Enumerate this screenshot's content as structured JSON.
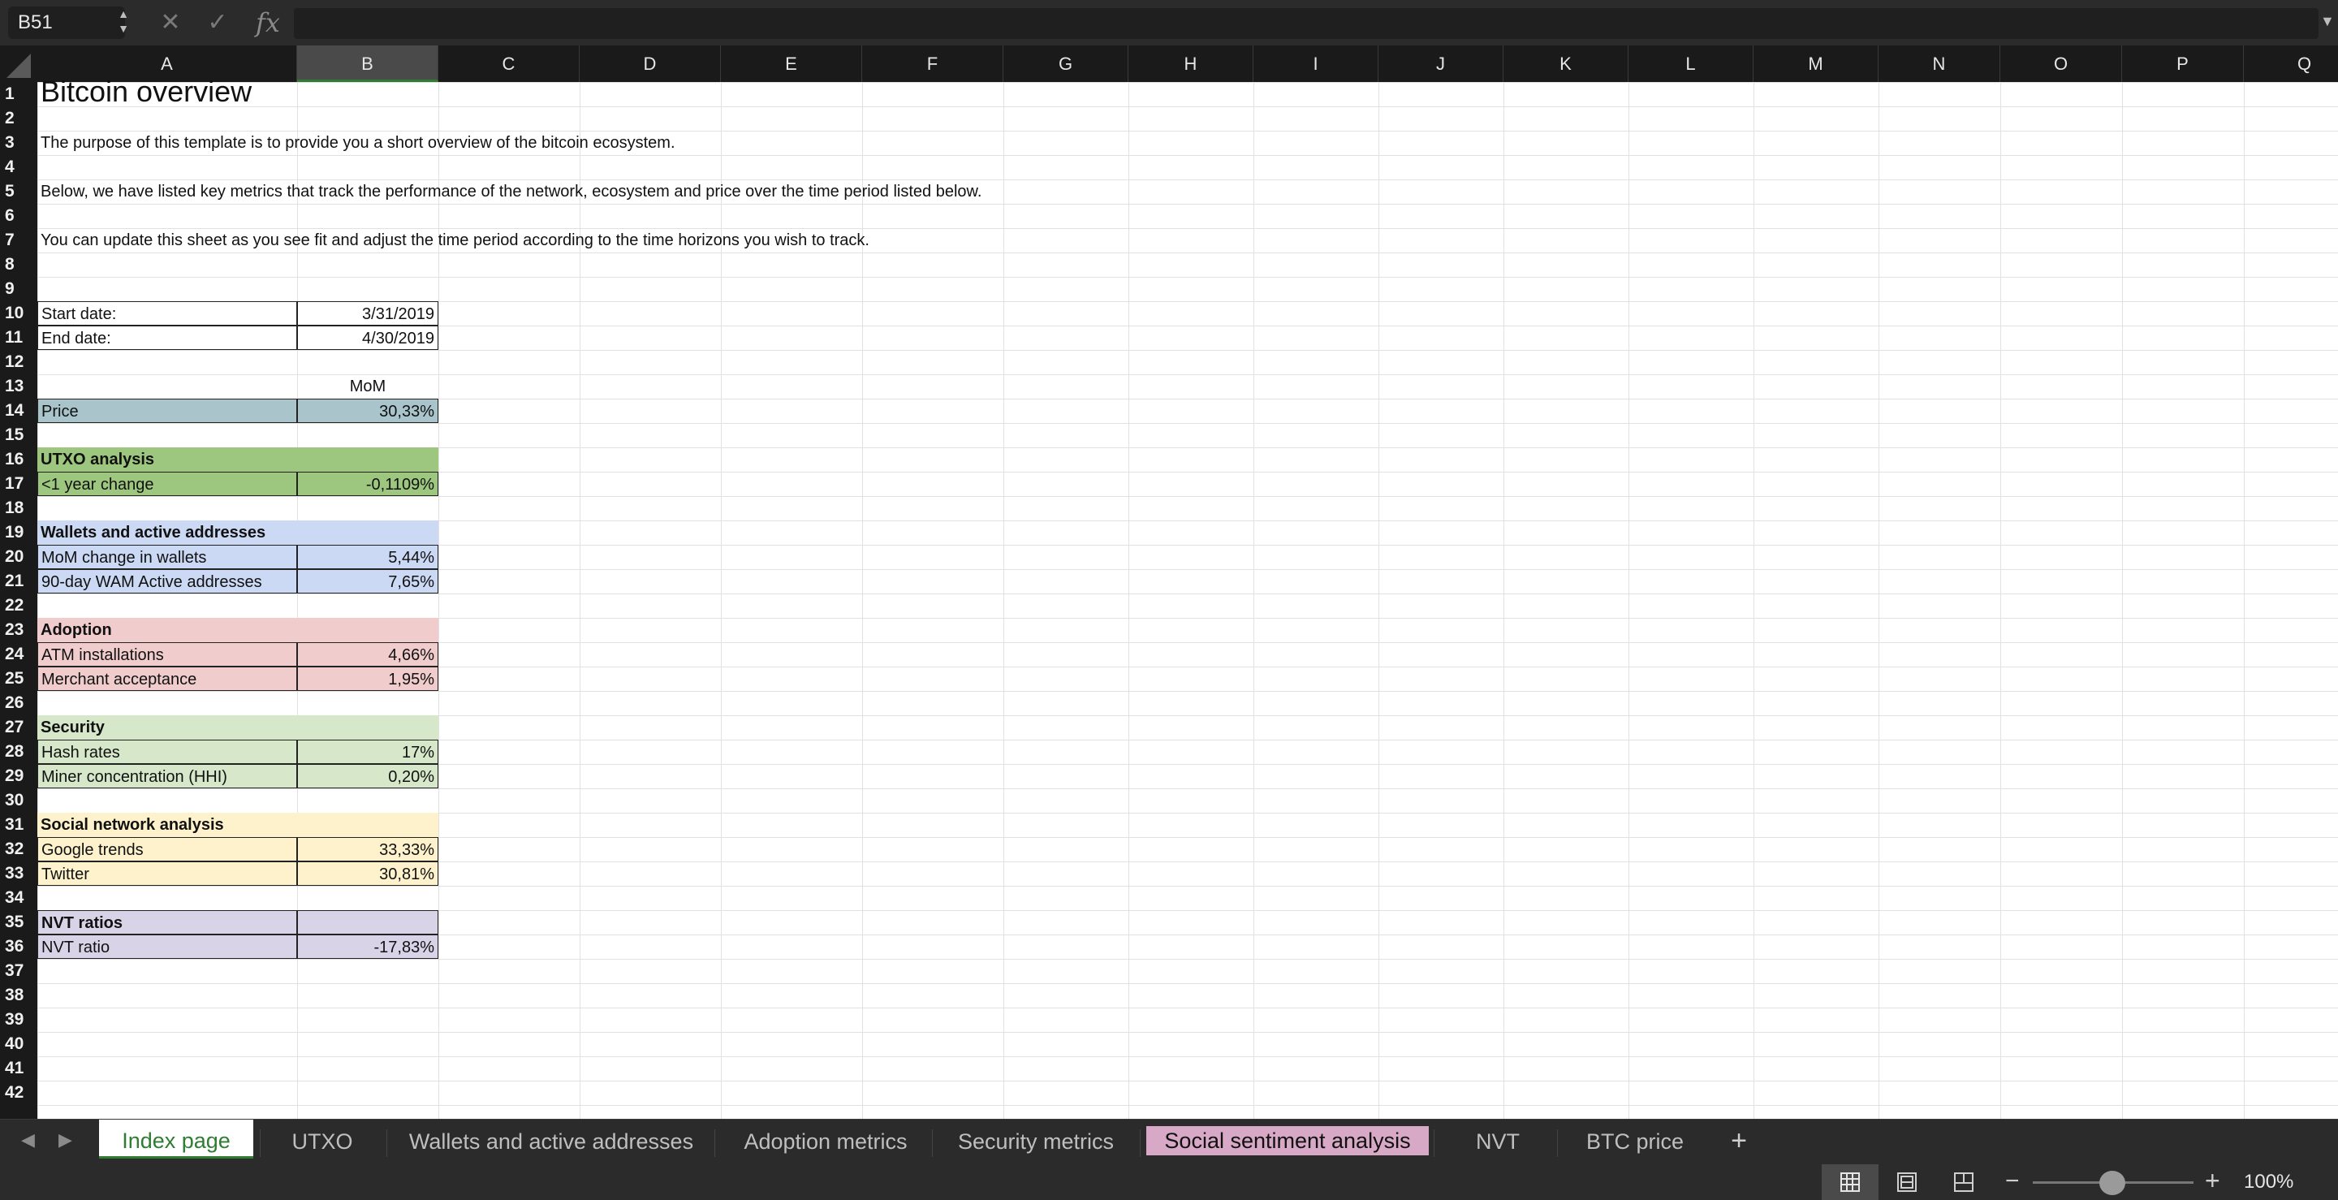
{
  "formula_bar": {
    "name_box": "B51",
    "formula": ""
  },
  "columns": [
    "A",
    "B",
    "C",
    "D",
    "E",
    "F",
    "G",
    "H",
    "I",
    "J",
    "K",
    "L",
    "M",
    "N",
    "O",
    "P",
    "Q"
  ],
  "selected_column": "B",
  "rows": [
    "1",
    "2",
    "3",
    "4",
    "5",
    "6",
    "7",
    "8",
    "9",
    "10",
    "11",
    "12",
    "13",
    "14",
    "15",
    "16",
    "17",
    "18",
    "19",
    "20",
    "21",
    "22",
    "23",
    "24",
    "25",
    "26",
    "27",
    "28",
    "29",
    "30",
    "31",
    "32",
    "33",
    "34",
    "35",
    "36",
    "37",
    "38",
    "39",
    "40",
    "41",
    "42"
  ],
  "sheet": {
    "title": "Bitcoin overview",
    "intro_1": "The purpose of this template is to provide you a short overview of the bitcoin ecosystem.",
    "intro_2": "Below, we have listed key metrics that track the performance of the network, ecosystem and price over the time period listed below.",
    "intro_3": "You can update this sheet as you see fit and adjust the time period according to the time horizons you wish to track.",
    "start_label": "Start date:",
    "start_value": "3/31/2019",
    "end_label": "End date:",
    "end_value": "4/30/2019",
    "mom_header": "MoM",
    "price_label": "Price",
    "price_value": "30,33%",
    "utxo_header": "UTXO analysis",
    "utxo_label": "<1 year change",
    "utxo_value": "-0,1109%",
    "wallets_header": "Wallets and active addresses",
    "wallets_label_1": "MoM change in wallets",
    "wallets_value_1": "5,44%",
    "wallets_label_2": "90-day WAM Active addresses",
    "wallets_value_2": "7,65%",
    "adoption_header": "Adoption",
    "adoption_label_1": "ATM installations",
    "adoption_value_1": "4,66%",
    "adoption_label_2": "Merchant acceptance",
    "adoption_value_2": "1,95%",
    "security_header": "Security",
    "security_label_1": "Hash rates",
    "security_value_1": "17%",
    "security_label_2": "Miner concentration (HHI)",
    "security_value_2": "0,20%",
    "social_header": "Social network analysis",
    "social_label_1": "Google trends",
    "social_value_1": "33,33%",
    "social_label_2": "Twitter",
    "social_value_2": "30,81%",
    "nvt_header": "NVT ratios",
    "nvt_label": "NVT ratio",
    "nvt_value": "-17,83%"
  },
  "colors": {
    "price": "#a9c4cb",
    "utxo": "#9dc77f",
    "wallets": "#cbd9f4",
    "adoption": "#f0cccc",
    "security": "#d6e8c9",
    "social": "#fdf2cc",
    "nvt": "#d9d3e8",
    "accent_green": "#2e7d32",
    "social_tab": "#d7a9c6"
  },
  "tabs": [
    {
      "label": "Index page",
      "active": true
    },
    {
      "label": "UTXO"
    },
    {
      "label": "Wallets and active addresses"
    },
    {
      "label": "Adoption metrics"
    },
    {
      "label": "Security metrics"
    },
    {
      "label": "Social sentiment analysis",
      "colored": true
    },
    {
      "label": "NVT"
    },
    {
      "label": "BTC price"
    }
  ],
  "status": {
    "zoom": "100%",
    "zoom_percent": 100
  }
}
